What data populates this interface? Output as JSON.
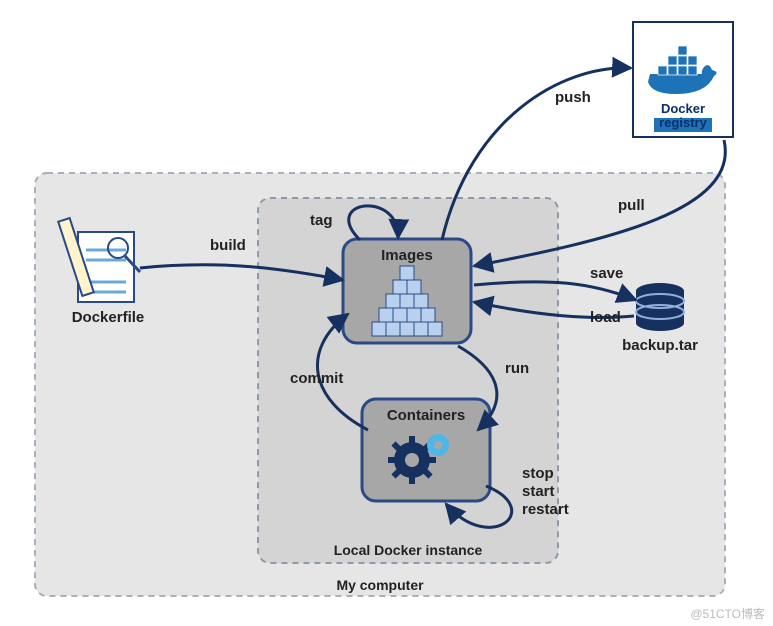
{
  "regions": {
    "computer": "My computer",
    "local": "Local Docker instance"
  },
  "nodes": {
    "dockerfile": "Dockerfile",
    "images": "Images",
    "containers": "Containers",
    "registry": "Docker registry",
    "backup": "backup.tar"
  },
  "edges": {
    "build": "build",
    "tag": "tag",
    "push": "push",
    "pull": "pull",
    "save": "save",
    "load": "load",
    "run": "run",
    "commit": "commit",
    "loop1": "stop",
    "loop2": "start",
    "loop3": "restart"
  },
  "watermark": "@51CTO博客",
  "chart_data": {
    "type": "diagram",
    "title": "Docker image/container command flow",
    "nodes": [
      {
        "id": "dockerfile",
        "label": "Dockerfile",
        "region": "My computer"
      },
      {
        "id": "images",
        "label": "Images",
        "region": "Local Docker instance"
      },
      {
        "id": "containers",
        "label": "Containers",
        "region": "Local Docker instance"
      },
      {
        "id": "registry",
        "label": "Docker registry",
        "region": "external"
      },
      {
        "id": "backup",
        "label": "backup.tar",
        "region": "My computer"
      }
    ],
    "edges": [
      {
        "from": "dockerfile",
        "to": "images",
        "label": "build"
      },
      {
        "from": "images",
        "to": "images",
        "label": "tag"
      },
      {
        "from": "images",
        "to": "registry",
        "label": "push"
      },
      {
        "from": "registry",
        "to": "images",
        "label": "pull"
      },
      {
        "from": "images",
        "to": "backup",
        "label": "save"
      },
      {
        "from": "backup",
        "to": "images",
        "label": "load"
      },
      {
        "from": "images",
        "to": "containers",
        "label": "run"
      },
      {
        "from": "containers",
        "to": "images",
        "label": "commit"
      },
      {
        "from": "containers",
        "to": "containers",
        "label": "stop / start / restart"
      }
    ],
    "regions": [
      {
        "id": "computer",
        "label": "My computer",
        "contains": [
          "dockerfile",
          "local",
          "backup"
        ]
      },
      {
        "id": "local",
        "label": "Local Docker instance",
        "contains": [
          "images",
          "containers"
        ]
      }
    ]
  }
}
